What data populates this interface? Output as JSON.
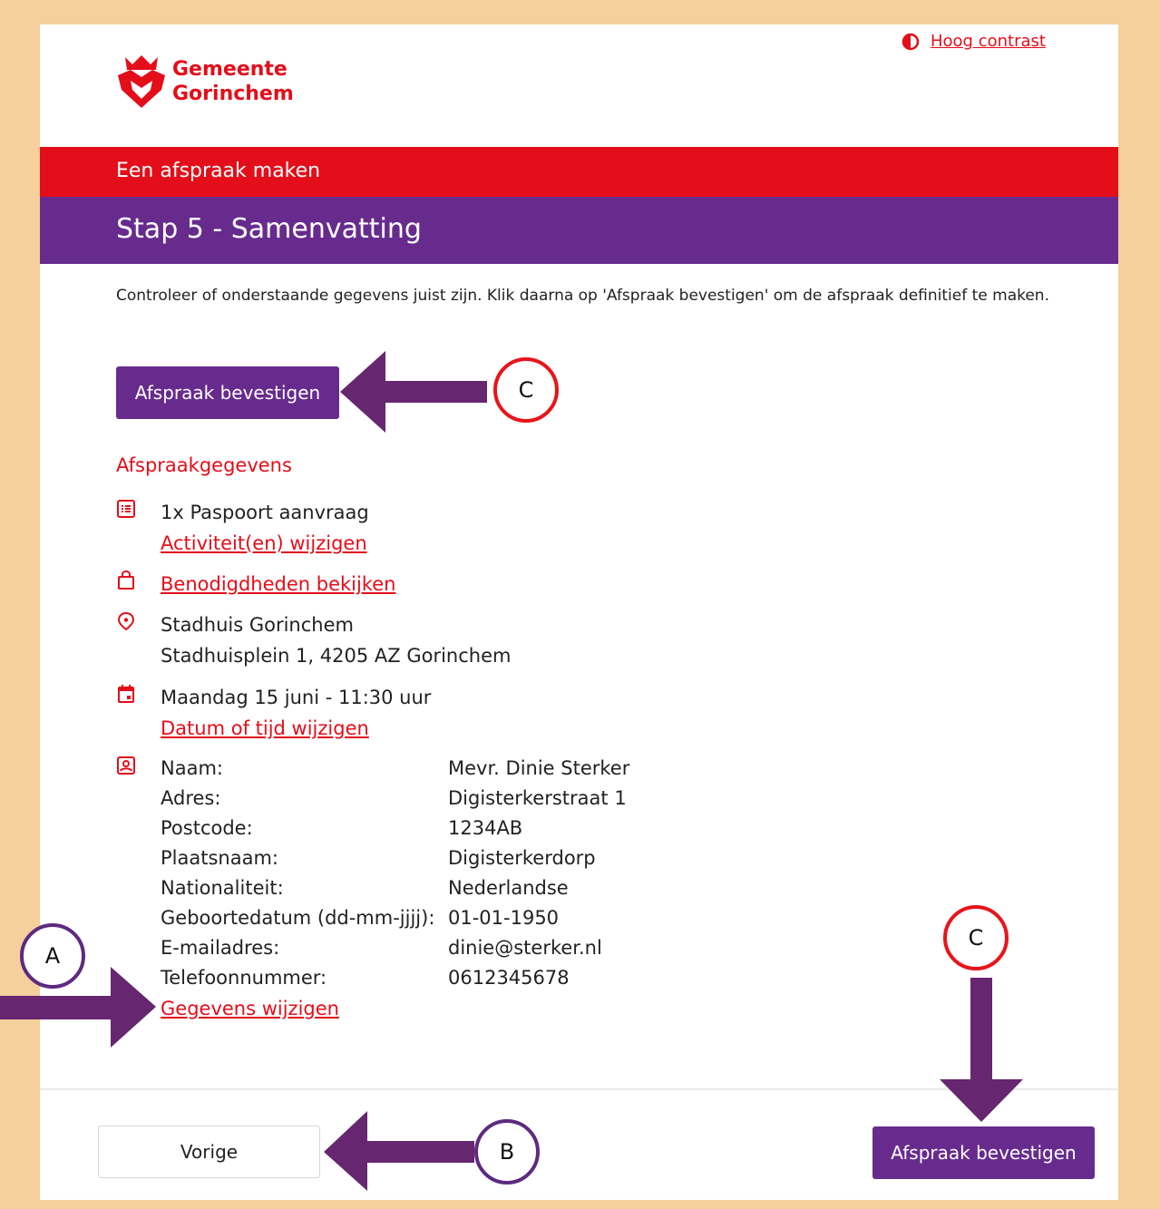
{
  "header": {
    "logo_line1": "Gemeente",
    "logo_line2": "Gorinchem",
    "contrast_link": "Hoog contrast"
  },
  "banner": {
    "title": "Een afspraak maken"
  },
  "step": {
    "title": "Stap 5 - Samenvatting"
  },
  "intro_text": "Controleer of onderstaande gegevens juist zijn. Klik daarna op 'Afspraak bevestigen' om de afspraak definitief te maken.",
  "confirm_label": "Afspraak bevestigen",
  "section_title": "Afspraakgegevens",
  "activity": {
    "text": "1x Paspoort aanvraag",
    "link": "Activiteit(en) wijzigen"
  },
  "requirements_link": "Benodigdheden bekijken",
  "location": {
    "name": "Stadhuis Gorinchem",
    "address": "Stadhuisplein 1, 4205 AZ Gorinchem"
  },
  "datetime": {
    "text": "Maandag 15 juni - 11:30 uur",
    "link": "Datum of tijd wijzigen"
  },
  "personal": {
    "rows": [
      {
        "label": "Naam:",
        "value": "Mevr. Dinie Sterker"
      },
      {
        "label": "Adres:",
        "value": "Digisterkerstraat 1"
      },
      {
        "label": "Postcode:",
        "value": "1234AB"
      },
      {
        "label": "Plaatsnaam:",
        "value": "Digisterkerdorp"
      },
      {
        "label": "Nationaliteit:",
        "value": "Nederlandse"
      },
      {
        "label": "Geboortedatum (dd-mm-jjjj):",
        "value": "01-01-1950"
      },
      {
        "label": "E-mailadres:",
        "value": "dinie@sterker.nl"
      },
      {
        "label": "Telefoonnummer:",
        "value": "0612345678"
      }
    ],
    "link": "Gegevens wijzigen"
  },
  "footer": {
    "previous_label": "Vorige",
    "confirm_label": "Afspraak bevestigen"
  },
  "annotations": {
    "a": "A",
    "b": "B",
    "c": "C"
  },
  "colors": {
    "brand_red": "#e30e1a",
    "brand_purple": "#672b8e",
    "frame": "#f5cf9c"
  },
  "icons": [
    "contrast-icon",
    "list-icon",
    "bag-icon",
    "location-pin-icon",
    "calendar-icon",
    "contact-card-icon"
  ]
}
